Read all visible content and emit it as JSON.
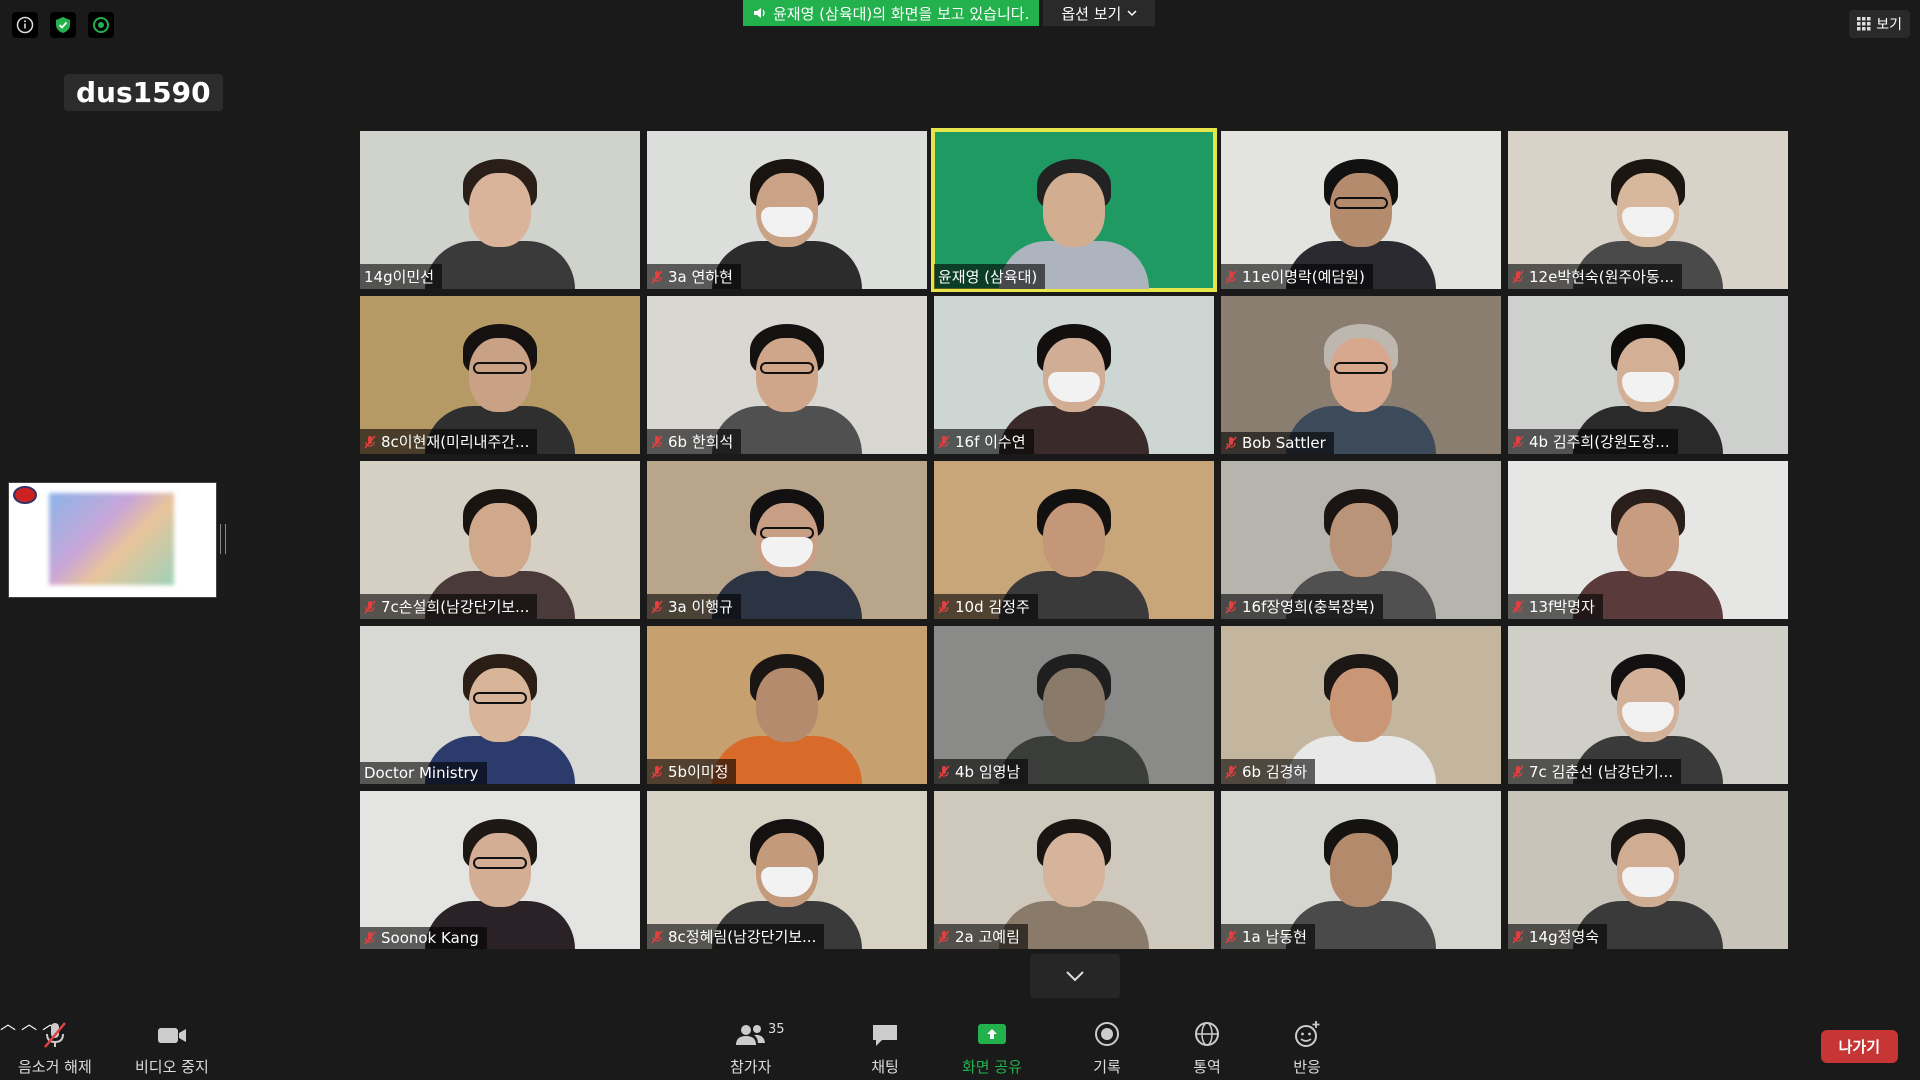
{
  "banner": {
    "sharing_text": "윤재영 (삼육대)의 화면을 보고 있습니다.",
    "options_label": "옵션 보기"
  },
  "view_button": "보기",
  "active_speaker_name": "dus1590",
  "participants": [
    {
      "name": "14g이민선",
      "muted": false,
      "bg": "#cfd3cc",
      "skin": "#d9b39a",
      "hair": "#2a1e18",
      "shirt": "#3a3a3a",
      "mask": false,
      "glasses": false
    },
    {
      "name": "3a 연하현",
      "muted": true,
      "bg": "#dcdedc",
      "skin": "#caa386",
      "hair": "#1a1410",
      "shirt": "#2c2c2c",
      "mask": true,
      "glasses": false
    },
    {
      "name": "윤재영 (삼육대)",
      "muted": false,
      "bg": "#1f9a62",
      "skin": "#d2ad90",
      "hair": "#222",
      "shirt": "#aeb4be",
      "mask": false,
      "glasses": false,
      "active": true
    },
    {
      "name": "11e이명락(예담원)",
      "muted": true,
      "bg": "#e3e3e0",
      "skin": "#b58b6e",
      "hair": "#111",
      "shirt": "#2a2a30",
      "mask": false,
      "glasses": true
    },
    {
      "name": "12e박현숙(원주아동...",
      "muted": true,
      "bg": "#d8d2c8",
      "skin": "#d8b89c",
      "hair": "#1c1612",
      "shirt": "#4a4a4a",
      "mask": true,
      "glasses": false
    },
    {
      "name": "8c이현재(미리내주간...",
      "muted": true,
      "bg": "#b69a66",
      "skin": "#c9a286",
      "hair": "#151110",
      "shirt": "#2f2f2f",
      "mask": false,
      "glasses": true
    },
    {
      "name": "6b 한희석",
      "muted": true,
      "bg": "#d9d7d2",
      "skin": "#cfa689",
      "hair": "#141210",
      "shirt": "#505050",
      "mask": false,
      "glasses": true
    },
    {
      "name": "16f 이수연",
      "muted": true,
      "bg": "#cdd6d2",
      "skin": "#d0ad94",
      "hair": "#120f0e",
      "shirt": "#3a2a2a",
      "mask": true,
      "glasses": false
    },
    {
      "name": "Bob Sattler",
      "muted": true,
      "bg": "#8a7e70",
      "skin": "#d8a88e",
      "hair": "#bdb7b0",
      "shirt": "#3d4a5a",
      "mask": false,
      "glasses": true
    },
    {
      "name": "4b 김주희(강원도장...",
      "muted": true,
      "bg": "#cdd0cd",
      "skin": "#d3af95",
      "hair": "#0f0d0c",
      "shirt": "#2a2a2a",
      "mask": true,
      "glasses": false
    },
    {
      "name": "7c손설희(남강단기보...",
      "muted": true,
      "bg": "#d6cfc4",
      "skin": "#d0a88c",
      "hair": "#1a1410",
      "shirt": "#4a3a3a",
      "mask": false,
      "glasses": false
    },
    {
      "name": "3a 이행규",
      "muted": true,
      "bg": "#b8a58a",
      "skin": "#c89f84",
      "hair": "#121010",
      "shirt": "#2c3444",
      "mask": true,
      "glasses": true
    },
    {
      "name": "10d 김정주",
      "muted": true,
      "bg": "#c9a57a",
      "skin": "#c49778",
      "hair": "#131010",
      "shirt": "#3a3a3a",
      "mask": false,
      "glasses": false
    },
    {
      "name": "16f장영희(충북장복)",
      "muted": true,
      "bg": "#b7b4ae",
      "skin": "#b99478",
      "hair": "#1a1512",
      "shirt": "#505050",
      "mask": false,
      "glasses": false
    },
    {
      "name": "13f박명자",
      "muted": true,
      "bg": "#e6e6e4",
      "skin": "#c89c80",
      "hair": "#2a1e1a",
      "shirt": "#5a3a3a",
      "mask": false,
      "glasses": false
    },
    {
      "name": "Doctor Ministry",
      "muted": false,
      "bg": "#d8d8d4",
      "skin": "#d8b498",
      "hair": "#2a1e16",
      "shirt": "#2b3b6b",
      "mask": false,
      "glasses": true
    },
    {
      "name": "5b이미정",
      "muted": true,
      "bg": "#c7a070",
      "skin": "#b58b6e",
      "hair": "#1a1614",
      "shirt": "#d86a2a",
      "mask": false,
      "glasses": false
    },
    {
      "name": "4b 임영남",
      "muted": true,
      "bg": "#8a8a88",
      "skin": "#8a7a6a",
      "hair": "#1f1f1f",
      "shirt": "#3a3d3a",
      "mask": false,
      "glasses": false
    },
    {
      "name": "6b 김경하",
      "muted": true,
      "bg": "#c4b59e",
      "skin": "#c99676",
      "hair": "#1b1714",
      "shirt": "#e8e8e8",
      "mask": false,
      "glasses": false
    },
    {
      "name": "7c 김춘선 (남강단기...",
      "muted": true,
      "bg": "#cfcfc8",
      "skin": "#d3b198",
      "hair": "#121010",
      "shirt": "#3a3a3a",
      "mask": true,
      "glasses": false
    },
    {
      "name": "Soonok Kang",
      "muted": true,
      "bg": "#e4e4e2",
      "skin": "#d4ae94",
      "hair": "#1e1814",
      "shirt": "#2a2226",
      "mask": false,
      "glasses": true
    },
    {
      "name": "8c정혜림(남강단기보...",
      "muted": true,
      "bg": "#d8d2c4",
      "skin": "#c39a7c",
      "hair": "#141110",
      "shirt": "#3a3a3a",
      "mask": true,
      "glasses": false
    },
    {
      "name": "2a 고예림",
      "muted": true,
      "bg": "#cfc8bc",
      "skin": "#d6b49c",
      "hair": "#1a1412",
      "shirt": "#8a7a6a",
      "mask": false,
      "glasses": false
    },
    {
      "name": "1a 남동현",
      "muted": true,
      "bg": "#d6d6d0",
      "skin": "#b48a6c",
      "hair": "#151312",
      "shirt": "#4a4a4a",
      "mask": false,
      "glasses": false
    },
    {
      "name": "14g정영숙",
      "muted": true,
      "bg": "#c9c4ba",
      "skin": "#d0ac92",
      "hair": "#1a1614",
      "shirt": "#3a3a3a",
      "mask": true,
      "glasses": false
    }
  ],
  "toolbar": {
    "unmute": "음소거 해제",
    "stop_video": "비디오 중지",
    "participants": "참가자",
    "participants_count": "35",
    "chat": "채팅",
    "share": "화면 공유",
    "record": "기록",
    "interpret": "통역",
    "reactions": "반응",
    "leave": "나가기"
  },
  "colors": {
    "share_green": "#22b14c",
    "active_border": "#e6e64a",
    "leave_red": "#c73535",
    "mute_red": "#e04040"
  }
}
